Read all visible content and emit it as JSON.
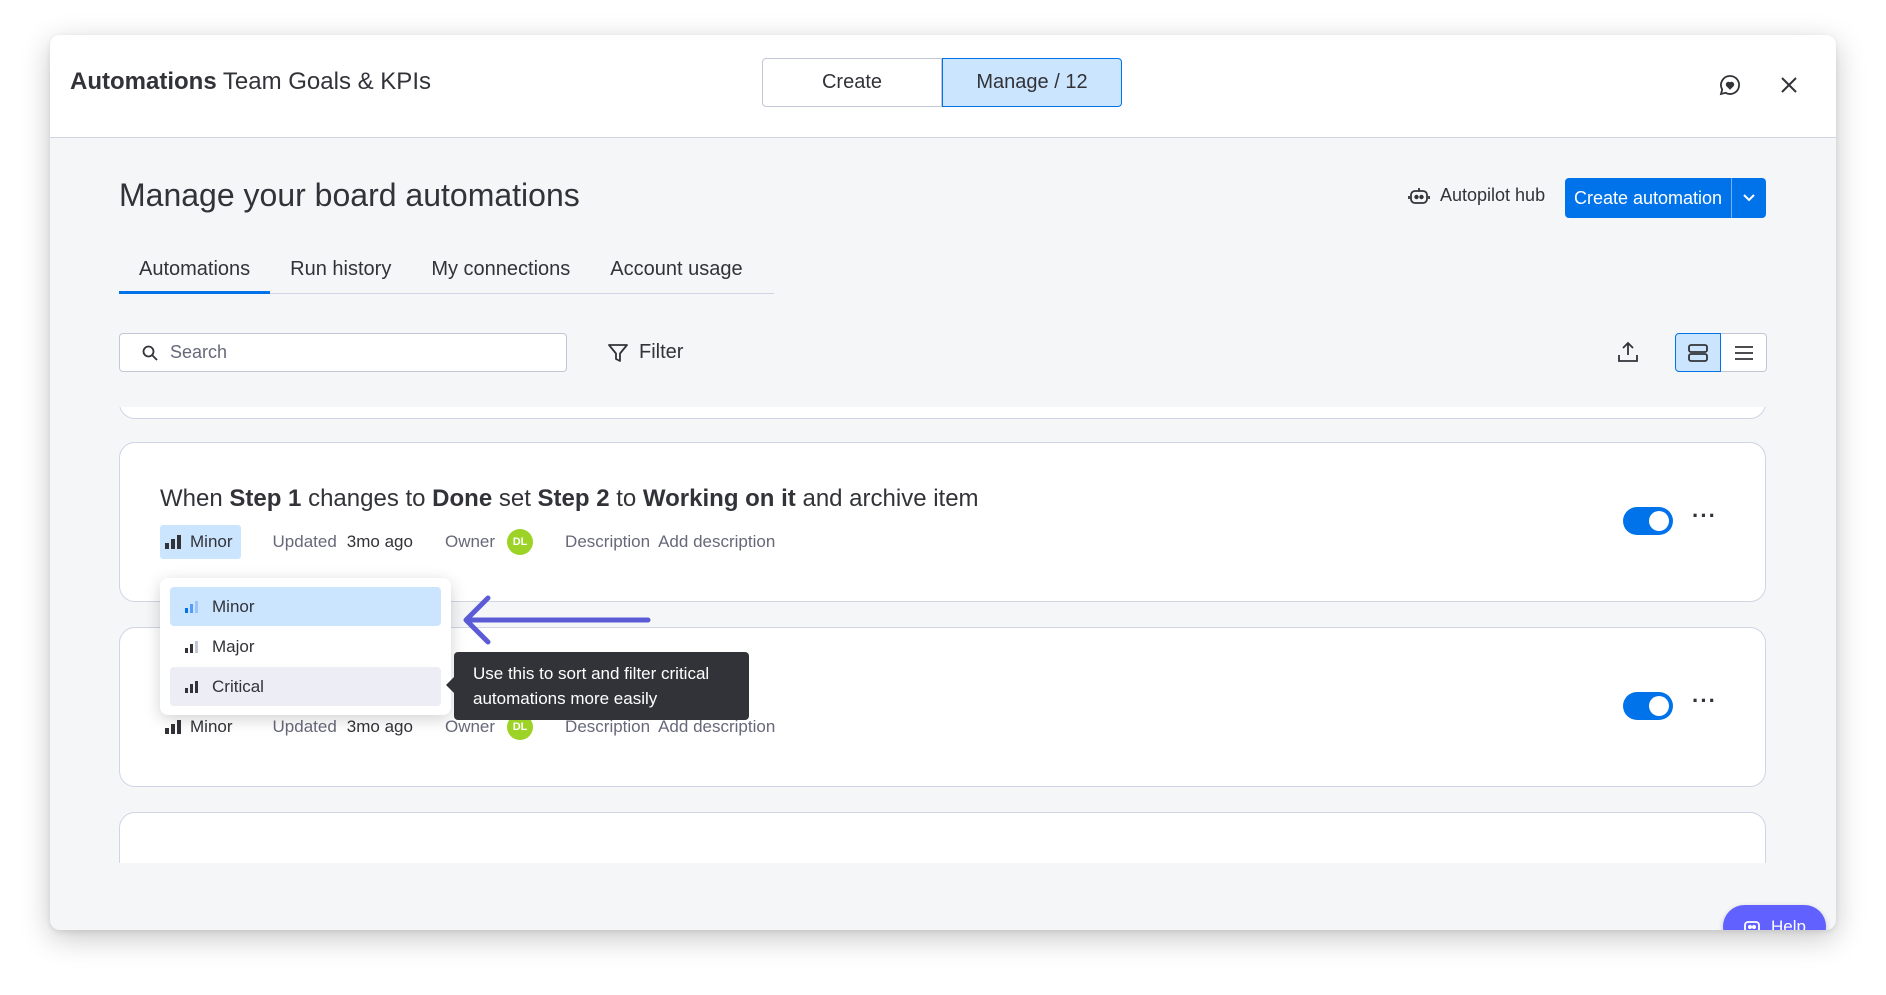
{
  "header": {
    "title_bold": "Automations",
    "title_rest": " Team Goals & KPIs",
    "tabs": [
      {
        "label": "Create"
      },
      {
        "label": "Manage / 12"
      }
    ]
  },
  "page": {
    "title": "Manage your board automations",
    "autopilot_label": "Autopilot hub",
    "create_label": "Create automation"
  },
  "nav_tabs": [
    {
      "label": "Automations"
    },
    {
      "label": "Run history"
    },
    {
      "label": "My connections"
    },
    {
      "label": "Account usage"
    }
  ],
  "toolbar": {
    "search_placeholder": "Search",
    "filter_label": "Filter"
  },
  "cards": [
    {
      "t1": "When ",
      "b1": "Step 1",
      "t2": " changes to ",
      "b2": "Done",
      "t3": " set ",
      "b3": "Step 2",
      "t4": " to ",
      "b4": "Working on it",
      "t5": " and archive item",
      "priority": "Minor",
      "updated_label": "Updated",
      "updated_value": "3mo ago",
      "owner_label": "Owner",
      "owner_initials": "DL",
      "description_label": "Description",
      "description_action": "Add description",
      "enabled": true
    },
    {
      "priority": "Minor",
      "updated_label": "Updated",
      "updated_value": "3mo ago",
      "owner_label": "Owner",
      "owner_initials": "DL",
      "description_label": "Description",
      "description_action": "Add description",
      "enabled": true
    }
  ],
  "priority_menu": {
    "options": [
      {
        "label": "Minor",
        "selected": true
      },
      {
        "label": "Major",
        "selected": false
      },
      {
        "label": "Critical",
        "selected": false
      }
    ]
  },
  "tooltip": {
    "text": "Use this to sort and filter critical automations more easily"
  },
  "help": {
    "label": "Help"
  },
  "colors": {
    "primary": "#0073ea",
    "selected_bg": "#cce5ff",
    "owner_avatar": "#9cd326",
    "help_button": "#6161ff",
    "annotation_arrow": "#5b5bd6"
  }
}
